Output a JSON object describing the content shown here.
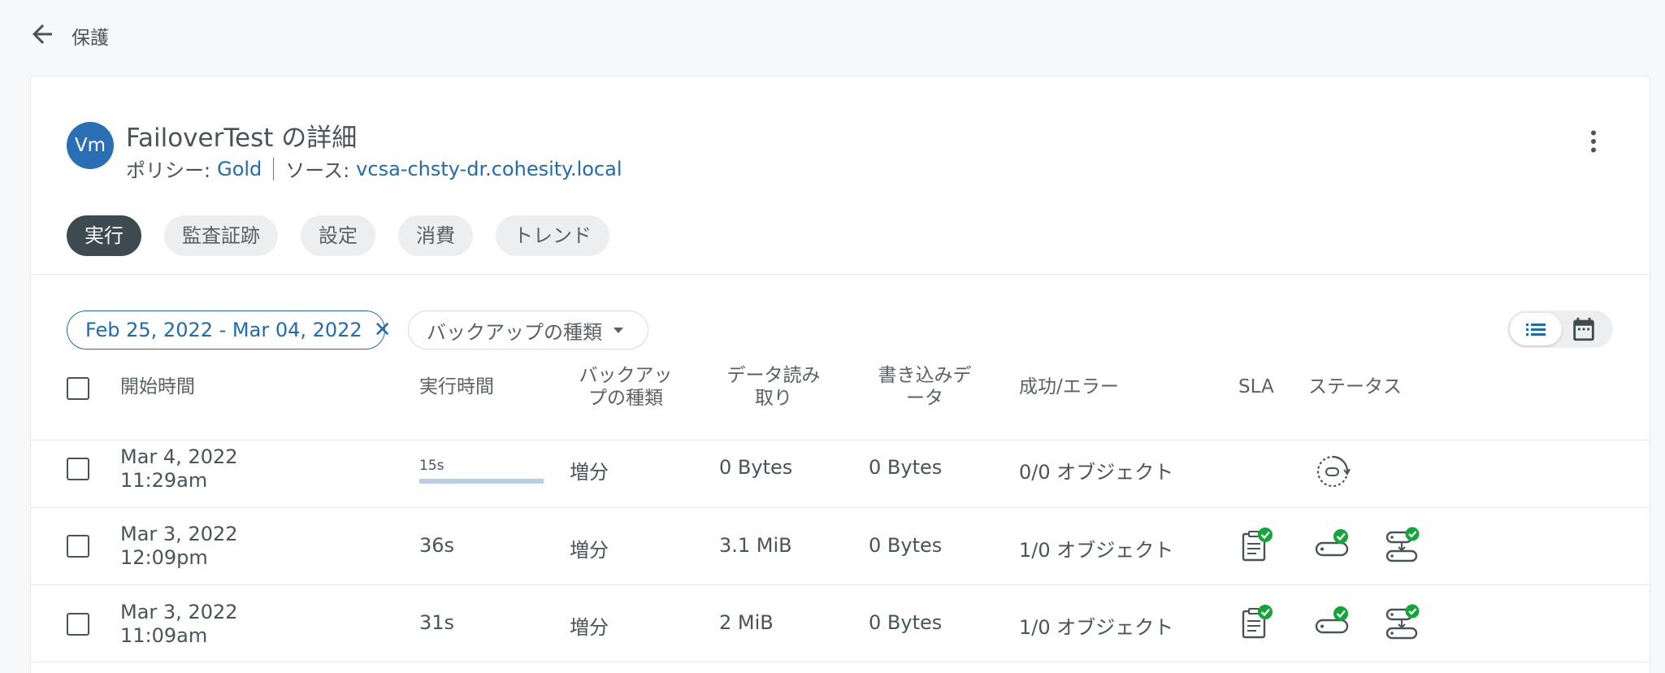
{
  "nav": {
    "back_label": "保護"
  },
  "job": {
    "avatar": "Vm",
    "title": "FailoverTest の詳細",
    "policy_label": "ポリシー:",
    "policy_value": "Gold",
    "source_label": "ソース:",
    "source_value": "vcsa-chsty-dr.cohesity.local"
  },
  "tabs": [
    {
      "label": "実行",
      "active": true
    },
    {
      "label": "監査証跡",
      "active": false
    },
    {
      "label": "設定",
      "active": false
    },
    {
      "label": "消費",
      "active": false
    },
    {
      "label": "トレンド",
      "active": false
    }
  ],
  "filters": {
    "date_range": "Feb 25, 2022 - Mar 04, 2022",
    "backup_type": "バックアップの種類"
  },
  "table": {
    "headers": {
      "start_time": "開始時間",
      "duration": "実行時間",
      "backup_type_1": "バックアッ",
      "backup_type_2": "プの種類",
      "data_read_1": "データ読み",
      "data_read_2": "取り",
      "data_written_1": "書き込みデ",
      "data_written_2": "ータ",
      "success_error": "成功/エラー",
      "sla": "SLA",
      "status": "ステータス"
    },
    "rows": [
      {
        "date": "Mar 4, 2022",
        "time": "11:29am",
        "duration": "15s",
        "duration_running": true,
        "type": "増分",
        "read": "0 Bytes",
        "written": "0 Bytes",
        "result": "0/0 オブジェクト",
        "status": "running"
      },
      {
        "date": "Mar 3, 2022",
        "time": "12:09pm",
        "duration": "36s",
        "duration_running": false,
        "type": "増分",
        "read": "3.1 MiB",
        "written": "0 Bytes",
        "result": "1/0 オブジェクト",
        "status": "success"
      },
      {
        "date": "Mar 3, 2022",
        "time": "11:09am",
        "duration": "31s",
        "duration_running": false,
        "type": "増分",
        "read": "2 MiB",
        "written": "0 Bytes",
        "result": "1/0 オブジェクト",
        "status": "success"
      }
    ]
  },
  "colors": {
    "accent": "#1f6bb3",
    "tab_active_bg": "#3d4a4f",
    "success": "#13a538",
    "avatar_bg": "#2a6fb4"
  },
  "icons": [
    "arrow-left-icon",
    "more-vert-icon",
    "close-icon",
    "caret-down-icon",
    "list-view-icon",
    "calendar-icon",
    "sla-clipboard-icon",
    "backup-storage-icon",
    "replication-storage-icon",
    "running-spinner-icon"
  ]
}
